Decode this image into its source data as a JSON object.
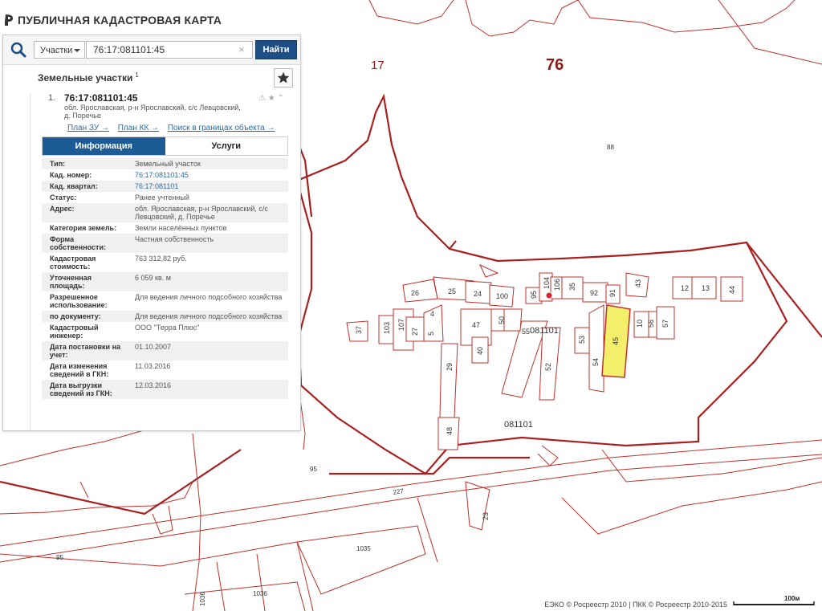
{
  "app": {
    "title": "ПУБЛИЧНАЯ КАДАСТРОВАЯ КАРТА"
  },
  "search": {
    "type_selected": "Участки",
    "query": "76:17:081101:45",
    "find_label": "Найти"
  },
  "results": {
    "title": "Земельные участки",
    "count": "1"
  },
  "result": {
    "number": "1.",
    "cad_number": "76:17:081101:45",
    "address": "обл. Ярославская, р-н Ярославский, с/с Левцовский, д. Поречье",
    "links": [
      "План ЗУ →",
      "План КК →",
      "Поиск в границах объекта →"
    ],
    "tabs": {
      "info": "Информация",
      "services": "Услуги"
    }
  },
  "info_rows": [
    {
      "k": "Тип:",
      "v": "Земельный участок"
    },
    {
      "k": "Кад. номер:",
      "v": "76:17:081101:45"
    },
    {
      "k": "Кад. квартал:",
      "v": "76:17:081101"
    },
    {
      "k": "Статус:",
      "v": "Ранее учтенный"
    },
    {
      "k": "Адрес:",
      "v": "обл. Ярославская, р-н Ярославский, с/с Левцовский, д. Поречье"
    },
    {
      "k": "Категория земель:",
      "v": "Земли населённых пунктов"
    },
    {
      "k": "Форма собственности:",
      "v": "Частная собственность"
    },
    {
      "k": "Кадастровая стоимость:",
      "v": "763 312,82 руб."
    },
    {
      "k": "Уточненная площадь:",
      "v": "6 059 кв. м"
    },
    {
      "k": "Разрешенное использование:",
      "v": "Для ведения личного подсобного хозяйства"
    },
    {
      "k": "по документу:",
      "v": "Для ведения личного подсобного хозяйства"
    },
    {
      "k": "Кадастровый инженер:",
      "v": "ООО \"Терра Плюс\""
    },
    {
      "k": "Дата постановки на учет:",
      "v": "01.10.2007"
    },
    {
      "k": "Дата изменения сведений в ГКН:",
      "v": "11.03.2016"
    },
    {
      "k": "Дата выгрузки сведений из ГКН:",
      "v": "12.03.2016"
    }
  ],
  "map": {
    "district_label": "76",
    "labels": {
      "l17": "17",
      "l88": "88",
      "l95a": "95",
      "l95b": "95",
      "l227": "227",
      "l1035": "1035",
      "l1036": "1036",
      "l1036b": "1036",
      "q081101a": "081101",
      "q081101b": "081101",
      "p26": "26",
      "p25": "25",
      "p24": "24",
      "p100": "100",
      "p95": "95",
      "p104": "104",
      "p106": "106",
      "p35": "35",
      "p92": "92",
      "p91": "91",
      "p43": "43",
      "p12": "12",
      "p13": "13",
      "p44": "44",
      "p37": "37",
      "p103": "103",
      "p107": "107",
      "p27": "27",
      "p4": "4",
      "p5": "5",
      "p47": "47",
      "p50": "50",
      "p55": "55",
      "p40": "40",
      "p29": "29",
      "p52": "52",
      "p53": "53",
      "p54": "54",
      "p45": "45",
      "p10": "10",
      "p56": "56",
      "p57": "57",
      "p48": "48",
      "p23": "23"
    }
  },
  "footer": {
    "copyright": "ЕЭКО © Росреестр 2010 | ПКК © Росреестр 2010-2015",
    "scale": "100м"
  },
  "colors": {
    "boundary": "#a8201f",
    "parcel": "#c0302c",
    "selected_fill": "#f3ef6a",
    "accent": "#1d4f86"
  }
}
